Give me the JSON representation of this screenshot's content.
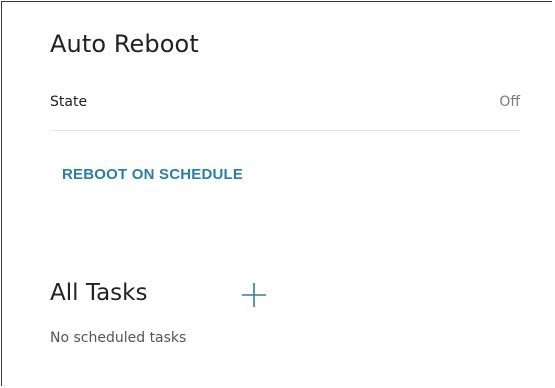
{
  "panel": {
    "title": "Auto Reboot",
    "state": {
      "label": "State",
      "value": "Off"
    },
    "schedule_link": "REBOOT ON SCHEDULE"
  },
  "tasks": {
    "title": "All Tasks",
    "add_icon": "plus-icon",
    "empty_message": "No scheduled tasks"
  },
  "colors": {
    "accent": "#2b7ea5",
    "text": "#222222",
    "muted": "#7a7a7a",
    "divider": "#e2e2e2"
  }
}
